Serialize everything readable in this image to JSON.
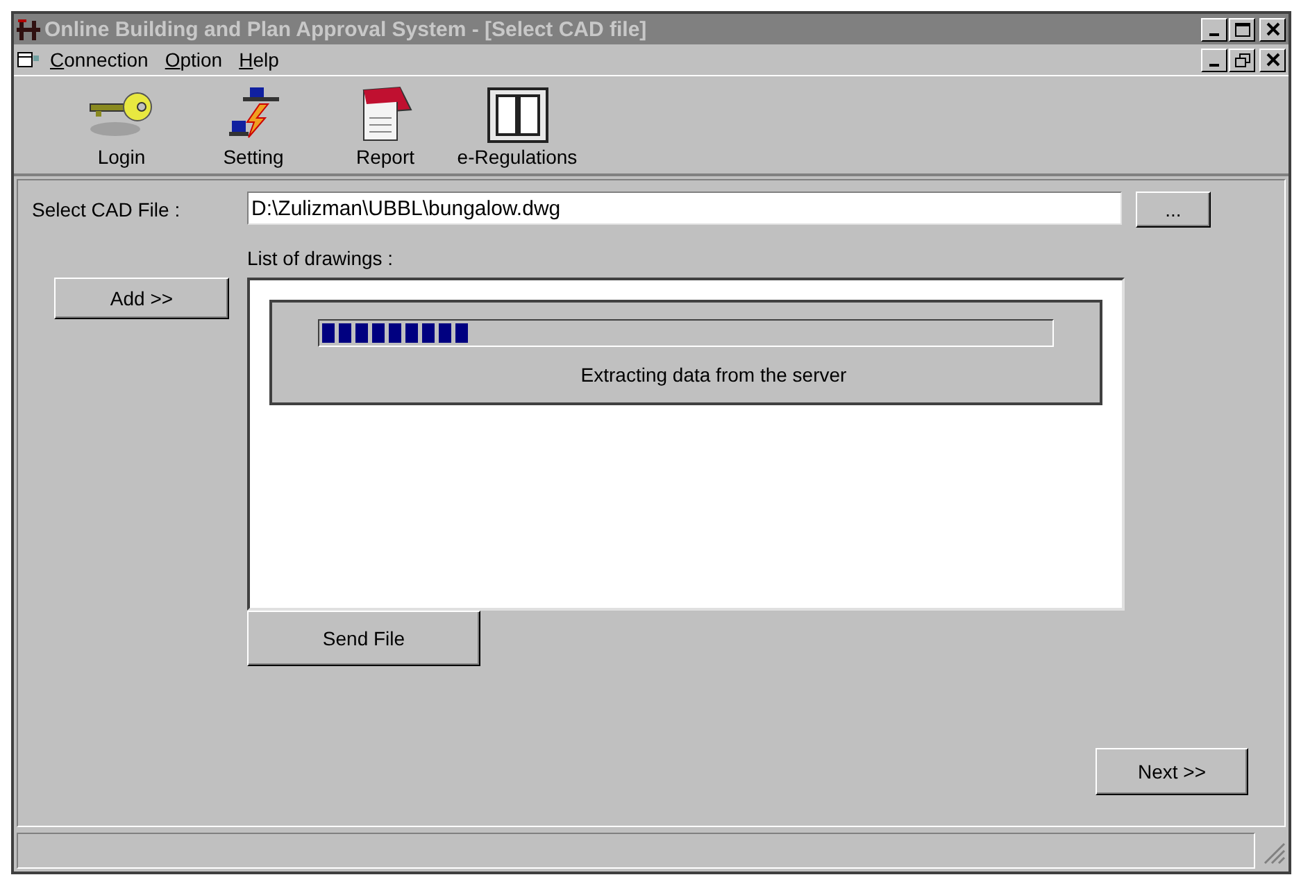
{
  "window": {
    "title": "Online Building and Plan Approval System - [Select CAD file]"
  },
  "menu": [
    {
      "accel": "C",
      "rest": "onnection"
    },
    {
      "accel": "O",
      "rest": "ption"
    },
    {
      "accel": "H",
      "rest": "elp"
    }
  ],
  "toolbar": [
    {
      "kind": "key",
      "label": "Login"
    },
    {
      "kind": "network",
      "label": "Setting"
    },
    {
      "kind": "notepad",
      "label": "Report"
    },
    {
      "kind": "book",
      "label": "e-Regulations"
    }
  ],
  "form": {
    "file_label": "Select CAD File :",
    "file_value": "D:\\Zulizman\\UBBL\\bungalow.dwg",
    "browse_button": "...",
    "list_label": "List of drawings :",
    "add_button": "Add >>",
    "send_button": "Send File",
    "next_button": "Next >>"
  },
  "progress": {
    "level": 0.2,
    "message": "Extracting data from the server"
  }
}
